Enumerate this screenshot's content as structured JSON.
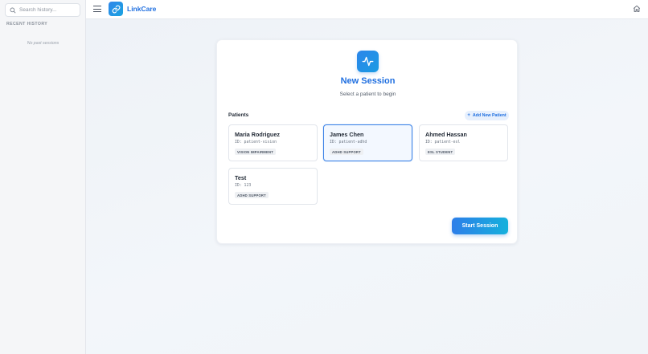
{
  "sidebar": {
    "search_placeholder": "Search history...",
    "recent_title": "RECENT HISTORY",
    "empty_text": "No past sessions"
  },
  "header": {
    "brand": "LinkCare",
    "icons": [
      "menu-icon",
      "link-icon",
      "home-icon"
    ]
  },
  "session": {
    "title": "New Session",
    "subtitle": "Select a patient to begin",
    "icon": "activity-icon"
  },
  "patients": {
    "label": "Patients",
    "add_label": "Add New Patient",
    "add_icon": "+",
    "items": [
      {
        "name": "Maria Rodriguez",
        "id": "ID: patient-vision",
        "tag": "VISION IMPAIRMENT",
        "selected": false
      },
      {
        "name": "James Chen",
        "id": "ID: patient-adhd",
        "tag": "ADHD SUPPORT",
        "selected": true
      },
      {
        "name": "Ahmed Hassan",
        "id": "ID: patient-esl",
        "tag": "ESL STUDENT",
        "selected": false
      },
      {
        "name": "Test",
        "id": "ID: 123",
        "tag": "ADHD SUPPORT",
        "selected": false
      }
    ]
  },
  "actions": {
    "start_label": "Start Session"
  },
  "colors": {
    "accent": "#1f6fe0",
    "selected_border": "#3b82e6",
    "gradient_start": "#2d7ee9",
    "gradient_end": "#15b0dc"
  }
}
